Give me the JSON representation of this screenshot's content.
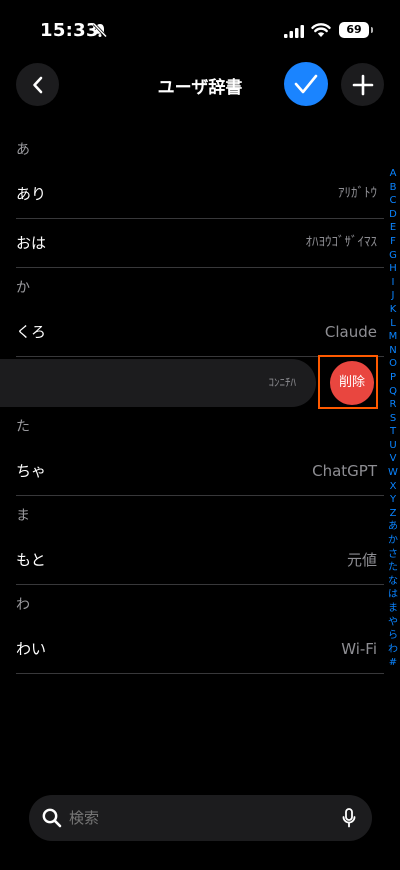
{
  "status_bar": {
    "time": "15:33",
    "battery": "69"
  },
  "nav": {
    "title": "ユーザ辞書"
  },
  "sections": [
    {
      "header": "あ",
      "rows": [
        {
          "reading": "あり",
          "word": "ｱﾘｶﾞﾄｳ"
        },
        {
          "reading": "おは",
          "word": "ｵﾊﾖｳｺﾞｻﾞｲﾏｽ"
        }
      ]
    },
    {
      "header": "か",
      "rows": [
        {
          "reading": "くろ",
          "word": "Claude"
        }
      ]
    },
    {
      "header": "た",
      "rows": [
        {
          "reading": "ちゃ",
          "word": "ChatGPT"
        }
      ]
    },
    {
      "header": "ま",
      "rows": [
        {
          "reading": "もと",
          "word": "元値"
        }
      ]
    },
    {
      "header": "わ",
      "rows": [
        {
          "reading": "わい",
          "word": "Wi-Fi"
        }
      ]
    }
  ],
  "swiped_row": {
    "word": "ｺﾝﾆﾁﾊ",
    "delete_label": "削除"
  },
  "index_letters": [
    "A",
    "B",
    "C",
    "D",
    "E",
    "F",
    "G",
    "H",
    "I",
    "J",
    "K",
    "L",
    "M",
    "N",
    "O",
    "P",
    "Q",
    "R",
    "S",
    "T",
    "U",
    "V",
    "W",
    "X",
    "Y",
    "Z",
    "あ",
    "か",
    "さ",
    "た",
    "な",
    "は",
    "ま",
    "や",
    "ら",
    "わ",
    "#"
  ],
  "search": {
    "placeholder": "検索"
  }
}
